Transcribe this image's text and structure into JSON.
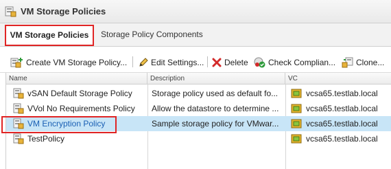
{
  "window": {
    "title": "VM Storage Policies",
    "title_icon": "storage-policy-icon"
  },
  "tabs": [
    {
      "label": "VM Storage Policies",
      "active": true
    },
    {
      "label": "Storage Policy Components",
      "active": false
    }
  ],
  "toolbar": {
    "create": "Create VM Storage Policy...",
    "edit": "Edit Settings...",
    "delete": "Delete",
    "check": "Check Complian...",
    "clone": "Clone..."
  },
  "table": {
    "columns": [
      "Name",
      "Description",
      "VC"
    ],
    "rows": [
      {
        "name": "vSAN Default Storage Policy",
        "description": "Storage policy used as default fo...",
        "vc": "vcsa65.testlab.local",
        "selected": false
      },
      {
        "name": "VVol No Requirements Policy",
        "description": "Allow the datastore to determine ...",
        "vc": "vcsa65.testlab.local",
        "selected": false
      },
      {
        "name": "VM Encryption Policy",
        "description": "Sample storage policy for VMwar...",
        "vc": "vcsa65.testlab.local",
        "selected": true
      },
      {
        "name": "TestPolicy",
        "description": "",
        "vc": "vcsa65.testlab.local",
        "selected": false
      }
    ]
  },
  "colors": {
    "highlight_red": "#e02424",
    "selected_row": "#c8e5f7",
    "link_blue": "#1a5fb4"
  }
}
